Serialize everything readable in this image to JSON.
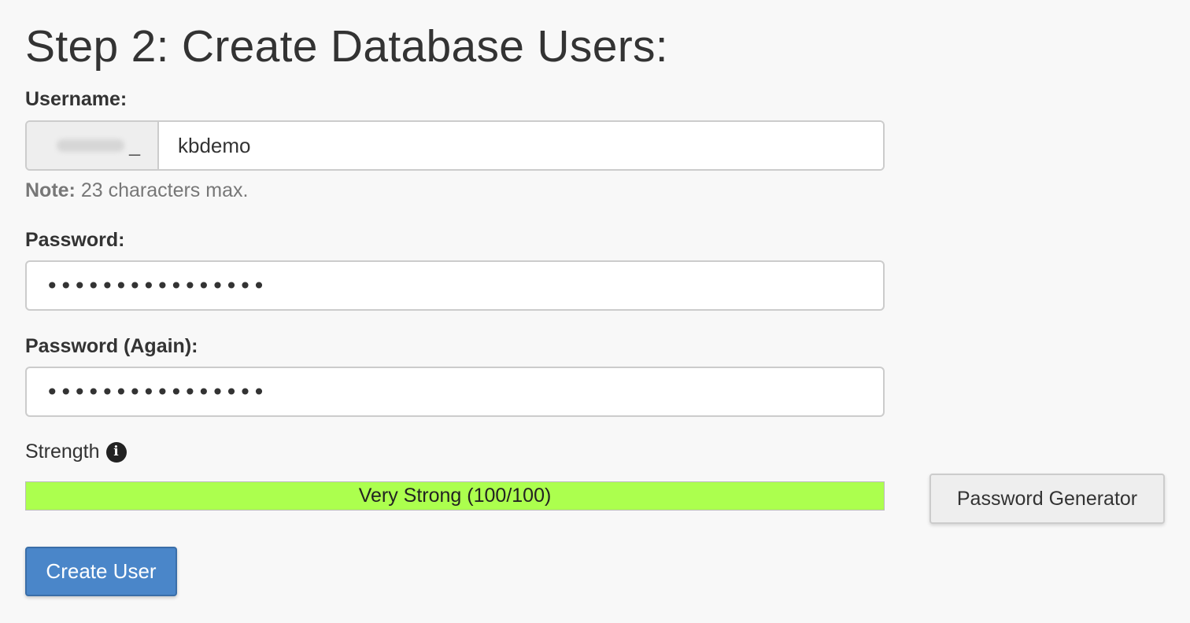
{
  "page": {
    "title": "Step 2: Create Database Users:"
  },
  "username": {
    "label": "Username:",
    "prefix_suffix": "_",
    "value": "kbdemo",
    "note_bold": "Note:",
    "note_text": " 23 characters max."
  },
  "password": {
    "label": "Password:",
    "value": "••••••••••••••••"
  },
  "password_again": {
    "label": "Password (Again):",
    "value": "••••••••••••••••"
  },
  "strength": {
    "label": "Strength",
    "info_icon": "info-circle-icon",
    "text": "Very Strong (100/100)",
    "score": 100,
    "fill_color": "#acff4e"
  },
  "buttons": {
    "password_generator": "Password Generator",
    "create_user": "Create User",
    "create_user_color": "#4a86c9"
  }
}
